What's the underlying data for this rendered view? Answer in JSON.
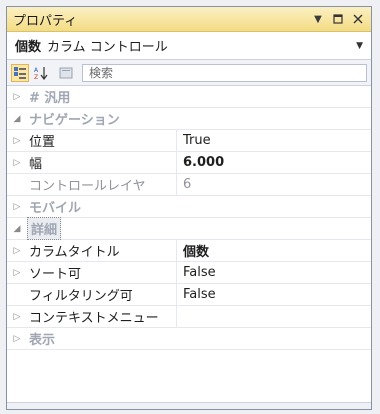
{
  "window": {
    "title": "プロパティ",
    "pin_icon": "pin-dropdown-icon",
    "max_icon": "maximize-icon",
    "close_icon": "close-icon"
  },
  "object_selector": {
    "name": "個数",
    "type": "カラム コントロール"
  },
  "toolbar": {
    "search_placeholder": "検索"
  },
  "grid": {
    "categories": [
      {
        "label": "# 汎用",
        "expanded": false,
        "selected": false,
        "rows": []
      },
      {
        "label": "ナビゲーション",
        "expanded": true,
        "selected": false,
        "rows": [
          {
            "name": "位置",
            "value": "True",
            "has_child": true,
            "bold": false,
            "disabled": false
          },
          {
            "name": "幅",
            "value": "6.000",
            "has_child": true,
            "bold": true,
            "disabled": false
          },
          {
            "name": "コントロールレイヤ",
            "value": "6",
            "has_child": false,
            "bold": false,
            "disabled": true
          }
        ]
      },
      {
        "label": "モバイル",
        "expanded": false,
        "selected": false,
        "rows": []
      },
      {
        "label": "詳細",
        "expanded": true,
        "selected": true,
        "rows": [
          {
            "name": "カラムタイトル",
            "value": "個数",
            "has_child": true,
            "bold": true,
            "disabled": false
          },
          {
            "name": "ソート可",
            "value": "False",
            "has_child": true,
            "bold": false,
            "disabled": false
          },
          {
            "name": "フィルタリング可",
            "value": "False",
            "has_child": false,
            "bold": false,
            "disabled": false
          },
          {
            "name": "コンテキストメニュー",
            "value": "",
            "has_child": true,
            "bold": false,
            "disabled": false
          }
        ]
      },
      {
        "label": "表示",
        "expanded": false,
        "selected": false,
        "rows": []
      }
    ]
  }
}
